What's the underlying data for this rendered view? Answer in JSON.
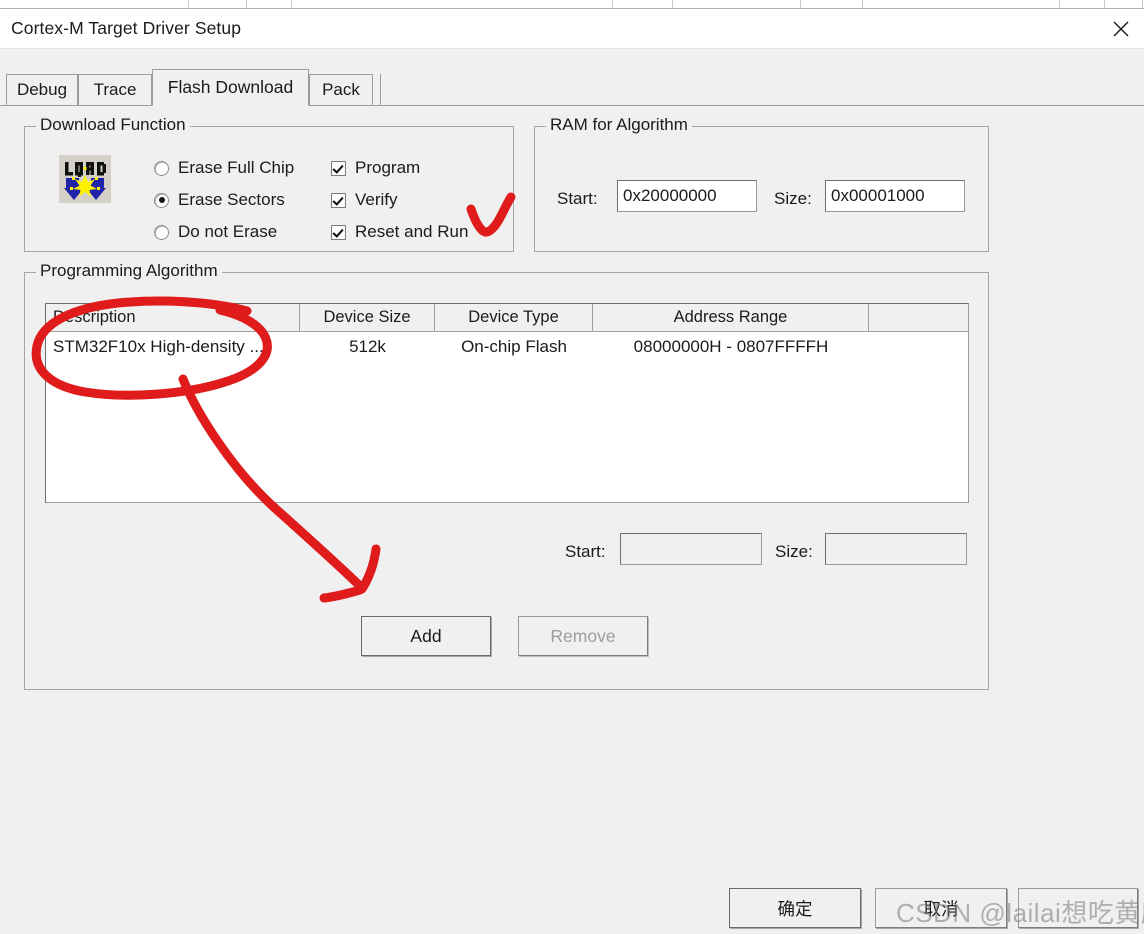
{
  "window": {
    "title": "Cortex-M Target Driver Setup",
    "close_icon": "close-icon"
  },
  "tabs": [
    {
      "label": "Debug",
      "active": false
    },
    {
      "label": "Trace",
      "active": false
    },
    {
      "label": "Flash Download",
      "active": true
    },
    {
      "label": "Pack",
      "active": false
    }
  ],
  "download_function": {
    "legend": "Download Function",
    "icon_text": "LOAD",
    "radios": [
      {
        "label": "Erase Full Chip",
        "selected": false
      },
      {
        "label": "Erase Sectors",
        "selected": true
      },
      {
        "label": "Do not Erase",
        "selected": false
      }
    ],
    "checkboxes": [
      {
        "label": "Program",
        "checked": true
      },
      {
        "label": "Verify",
        "checked": true
      },
      {
        "label": "Reset and Run",
        "checked": true
      }
    ]
  },
  "ram_for_algorithm": {
    "legend": "RAM for Algorithm",
    "start_label": "Start:",
    "start_value": "0x20000000",
    "size_label": "Size:",
    "size_value": "0x00001000"
  },
  "programming_algorithm": {
    "legend": "Programming Algorithm",
    "columns": [
      "Description",
      "Device Size",
      "Device Type",
      "Address Range",
      ""
    ],
    "rows": [
      {
        "description": "STM32F10x High-density ...",
        "device_size": "512k",
        "device_type": "On-chip Flash",
        "address_range": "08000000H - 0807FFFFH",
        "extra": ""
      }
    ],
    "start_label": "Start:",
    "start_value": "",
    "size_label": "Size:",
    "size_value": "",
    "add_button": "Add",
    "remove_button": "Remove"
  },
  "footer": {
    "ok_button": "确定",
    "cancel_button": "取消",
    "help_button": ""
  },
  "watermark": "CSDN @lailai想吃黄麻薯",
  "annotation": {
    "color": "#e01b1b",
    "marks": [
      "check-over-reset-and-run",
      "ellipse-around-description-column",
      "arrow-to-add-button"
    ]
  }
}
